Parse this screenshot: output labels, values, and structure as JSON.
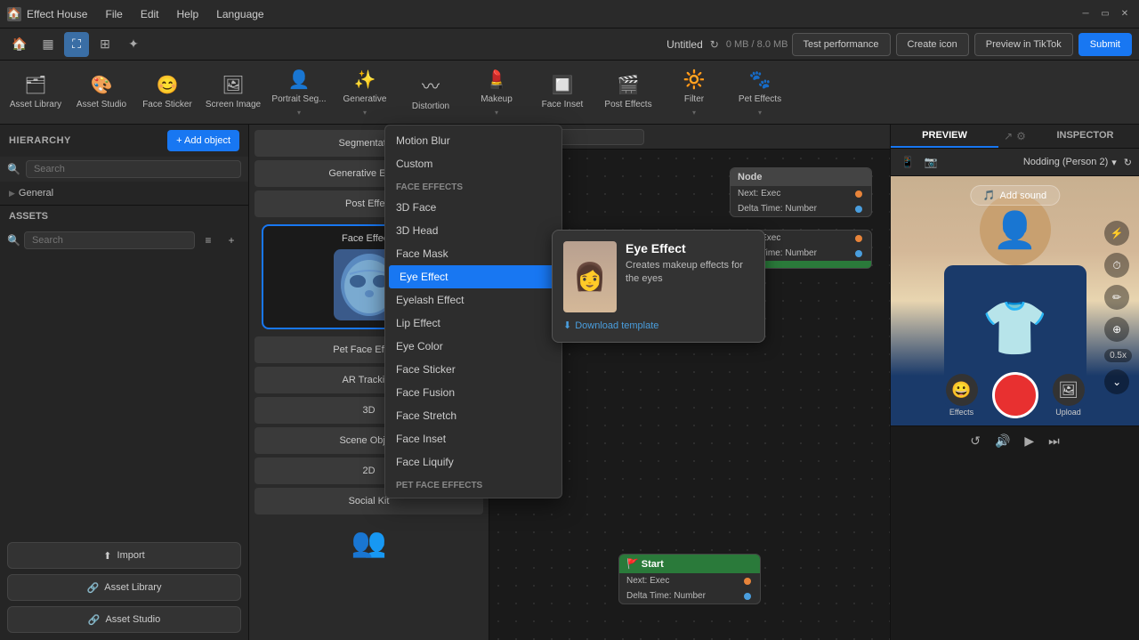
{
  "app": {
    "title": "Effect House",
    "menus": [
      "File",
      "Edit",
      "Help",
      "Language"
    ],
    "window_controls": [
      "minimize",
      "maximize",
      "close"
    ]
  },
  "toolbar": {
    "project_name": "Untitled",
    "file_size": "0 MB / 8.0 MB",
    "test_performance": "Test performance",
    "create_icon": "Create icon",
    "preview_tiktok": "Preview in TikTok",
    "submit": "Submit"
  },
  "asset_tools": [
    {
      "id": "asset-library",
      "label": "Asset Library",
      "icon": "🗂"
    },
    {
      "id": "asset-studio",
      "label": "Asset Studio",
      "icon": "🎨"
    },
    {
      "id": "face-sticker",
      "label": "Face Sticker",
      "icon": "😊"
    },
    {
      "id": "screen-image",
      "label": "Screen Image",
      "icon": "🖼"
    },
    {
      "id": "portrait-seg",
      "label": "Portrait Seg...",
      "icon": "👤",
      "has_arrow": true
    },
    {
      "id": "generative",
      "label": "Generative",
      "icon": "✨",
      "has_arrow": true
    },
    {
      "id": "distortion",
      "label": "Distortion",
      "icon": "〰"
    },
    {
      "id": "makeup",
      "label": "Makeup",
      "icon": "💄",
      "has_arrow": true
    },
    {
      "id": "face-inset",
      "label": "Face Inset",
      "icon": "🔲"
    },
    {
      "id": "post-effects",
      "label": "Post Effects",
      "icon": "🎬"
    },
    {
      "id": "filter",
      "label": "Filter",
      "icon": "🔆",
      "has_arrow": true
    },
    {
      "id": "pet-effects",
      "label": "Pet Effects",
      "icon": "🐾",
      "has_arrow": true
    }
  ],
  "hierarchy": {
    "title": "HIERARCHY",
    "search_placeholder": "Search",
    "add_object_label": "+ Add object",
    "items": [
      {
        "label": "General",
        "type": "group",
        "expanded": true
      }
    ]
  },
  "assets": {
    "title": "ASSETS",
    "search_placeholder": "Search",
    "import_label": "Import",
    "asset_library_label": "Asset Library",
    "asset_studio_label": "Asset Studio"
  },
  "effect_nodes": [
    {
      "id": "segmentation",
      "label": "Segmentation"
    },
    {
      "id": "generative-effects",
      "label": "Generative Effects"
    },
    {
      "id": "post-effect",
      "label": "Post Effect"
    },
    {
      "id": "face-effects",
      "label": "Face Effects",
      "selected": true
    },
    {
      "id": "pet-face-effects",
      "label": "Pet Face Effects"
    },
    {
      "id": "ar-tracking",
      "label": "AR Tracking"
    },
    {
      "id": "3d",
      "label": "3D"
    },
    {
      "id": "scene-object",
      "label": "Scene Object"
    },
    {
      "id": "2d",
      "label": "2D"
    },
    {
      "id": "social-kit",
      "label": "Social Kit"
    }
  ],
  "dropdown": {
    "top_items": [
      {
        "id": "motion-blur",
        "label": "Motion Blur"
      },
      {
        "id": "custom",
        "label": "Custom"
      }
    ],
    "section_label": "Face Effects",
    "face_effect_items": [
      {
        "id": "3d-face",
        "label": "3D Face"
      },
      {
        "id": "3d-head",
        "label": "3D Head"
      },
      {
        "id": "face-mask",
        "label": "Face Mask"
      },
      {
        "id": "eye-effect",
        "label": "Eye Effect",
        "selected": true
      },
      {
        "id": "eyelash-effect",
        "label": "Eyelash Effect"
      },
      {
        "id": "lip-effect",
        "label": "Lip Effect"
      },
      {
        "id": "eye-color",
        "label": "Eye Color"
      },
      {
        "id": "face-sticker",
        "label": "Face Sticker"
      },
      {
        "id": "face-fusion",
        "label": "Face Fusion"
      },
      {
        "id": "face-stretch",
        "label": "Face Stretch"
      },
      {
        "id": "face-inset",
        "label": "Face Inset"
      },
      {
        "id": "face-liquify",
        "label": "Face Liquify"
      }
    ],
    "pet_section_label": "Pet Face Effects"
  },
  "tooltip": {
    "title": "Eye Effect",
    "description": "Creates makeup effects for the eyes",
    "download_template": "Download template"
  },
  "preview": {
    "title": "PREVIEW",
    "model_name": "Nodding (Person 2)",
    "add_sound_label": "Add sound",
    "speed_label": "0.5x"
  },
  "inspector": {
    "title": "INSPECTOR"
  },
  "node_graph": {
    "start_node": {
      "label": "Start",
      "port_next": "Next: Exec",
      "port_delta": "Delta Time: Number"
    },
    "exec_node": {
      "port_next": "Next: Exec",
      "port_delta": "Delta Time: Number"
    }
  }
}
